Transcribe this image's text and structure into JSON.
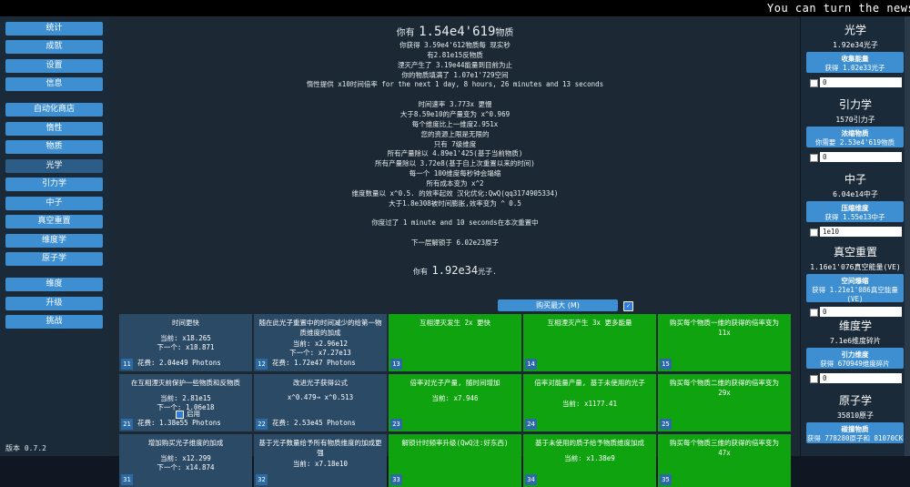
{
  "ticker": "You can turn the newst",
  "sidebar": {
    "items": [
      "统计",
      "成就",
      "设置",
      "信息",
      "自动化商店",
      "惰性",
      "物质",
      "光学",
      "引力学",
      "中子",
      "真空重置",
      "维度学",
      "原子学",
      "维度",
      "升级",
      "挑战"
    ],
    "active": "光学",
    "version": "版本 0.7.2"
  },
  "center": {
    "matter_prefix": "你有",
    "matter_value": "1.54e4'619",
    "matter_suffix": "物质",
    "lines": [
      "你获得 3.59e4'612物质每 现实秒",
      "有2.81e15反物质",
      "湮灭产生了 3.19e44能量到目前为止",
      "你的物质填满了 1.07e1'729空间",
      "惰性提供 x10时间倍率 for the next 1 day, 8 hours, 26 minutes and 13 seconds",
      "",
      "时间速率 3.773x 更慢",
      "大于8.59e10的产量变为 x^0.969",
      "每个维度比上一维度2.951x",
      "您的资源上限是无限的",
      "只有 7级维度",
      "所有产量除以 4.89e1'425(基于当前物质)",
      "所有产量除以 3.72e8(基于自上次重置以来的时间)",
      "每一个 100维度每秒钟会塌缩",
      "所有成本变为 x^2",
      "维度数量以 x^0.5. 的效率起效 汉化优化:QwQ(qq3174905334)",
      "大于1.8e308被时间膨胀,效率变为 ^ 0.5",
      "",
      "你度过了 1 minute and 10 seconds在本次重置中",
      "",
      "下一层解锁于 6.02e23原子"
    ],
    "photon_prefix": "你有",
    "photon_value": "1.92e34",
    "photon_suffix": "光子.",
    "buy_max_label": "购买最大 (M)",
    "buy_max_check": "✓",
    "upgrades": [
      {
        "num": "11",
        "color": "blue",
        "title": "时间更快",
        "l1": "当前: x18.265",
        "l2": "下一个: x18.871",
        "cost": "花费: 2.04e49 Photons"
      },
      {
        "num": "12",
        "color": "blue",
        "title": "随在此光子重置中的时间减少的给第一物质维度的加成",
        "l1": "当前: x2.96e12",
        "l2": "下一个: x7.27e13",
        "cost": "花费: 1.72e47 Photons"
      },
      {
        "num": "13",
        "color": "green",
        "title": "互相湮灭发生 2x 更快",
        "l1": "",
        "l2": "",
        "cost": ""
      },
      {
        "num": "14",
        "color": "green",
        "title": "互相湮灭产生 3x 更多能量",
        "l1": "",
        "l2": "",
        "cost": ""
      },
      {
        "num": "15",
        "color": "green",
        "title": "购买每个物质一维的获得的倍率变为 11x",
        "l1": "",
        "l2": "",
        "cost": ""
      },
      {
        "num": "21",
        "color": "blue",
        "title": "在互相湮灭前保护一些物质和反物质",
        "l1": "当前: 2.81e15",
        "l2": "下一个: 1.06e18",
        "cost": "花费: 1.38e55 Photons",
        "toggle": "启用"
      },
      {
        "num": "22",
        "color": "blue",
        "title": "改进光子获得公式",
        "l1": "x^0.479→ x^0.513",
        "l2": "",
        "cost": "花费: 2.53e45 Photons"
      },
      {
        "num": "23",
        "color": "green",
        "title": "倍率对光子产量, 随时间增加",
        "l1": "当前: x7.946",
        "l2": "",
        "cost": ""
      },
      {
        "num": "24",
        "color": "green",
        "title": "倍率对能量产量, 基于未使用的光子",
        "l1": "当前: x1177.41",
        "l2": "",
        "cost": ""
      },
      {
        "num": "25",
        "color": "green",
        "title": "购买每个物质二维的获得的倍率变为 29x",
        "l1": "",
        "l2": "",
        "cost": ""
      },
      {
        "num": "31",
        "color": "blue",
        "title": "增加购买光子维度的加成",
        "l1": "当前: x12.299",
        "l2": "下一个: x14.874",
        "cost": ""
      },
      {
        "num": "32",
        "color": "blue",
        "title": "基于光子数量给予所有物质维度的加成更强",
        "l1": "当前: x7.18e10",
        "l2": "",
        "cost": ""
      },
      {
        "num": "33",
        "color": "green",
        "title": "解锁计时频率升级(QwQ注:好东西)",
        "l1": "",
        "l2": "",
        "cost": ""
      },
      {
        "num": "34",
        "color": "green",
        "title": "基于未使用的质子给予物质维度加成",
        "l1": "当前: x1.38e9",
        "l2": "",
        "cost": ""
      },
      {
        "num": "35",
        "color": "green",
        "title": "购买每个物质三维的获得的倍率变为 47x",
        "l1": "",
        "l2": "",
        "cost": ""
      }
    ]
  },
  "right": {
    "sections": [
      {
        "head": "光学",
        "sub": "1.92e34光子",
        "btn1": "收集能量",
        "btn2": "获得 1.02e33光子",
        "input": "0"
      },
      {
        "head": "引力学",
        "sub": "1570引力子",
        "btn1": "浓缩物质",
        "btn2": "你需要 2.53e4'619物质",
        "input": "0"
      },
      {
        "head": "中子",
        "sub": "6.04e14中子",
        "btn1": "压缩维度",
        "btn2": "获得 1.55e13中子",
        "input": "1e10"
      },
      {
        "head": "真空重置",
        "sub": "1.16e1'076真空能量(VE)",
        "btn1": "空间爆缩",
        "btn2": "获得 1.21e1'086真空能量(VE)",
        "input": "0"
      },
      {
        "head": "维度学",
        "sub": "7.1e6维度碎片",
        "btn1": "引力维度",
        "btn2": "获得 670949维度碎片",
        "input": "0"
      },
      {
        "head": "原子学",
        "sub": "35810原子",
        "btn1": "碰撞物质",
        "btn2": "获得 778280原子和 81070CK",
        "input": ""
      }
    ]
  },
  "colors": {
    "accent": "#3e8ed2",
    "card_blue": "#2b4a66",
    "card_green": "#0fa30f",
    "panel": "#1a2a38",
    "center_bg": "#1c2833"
  }
}
